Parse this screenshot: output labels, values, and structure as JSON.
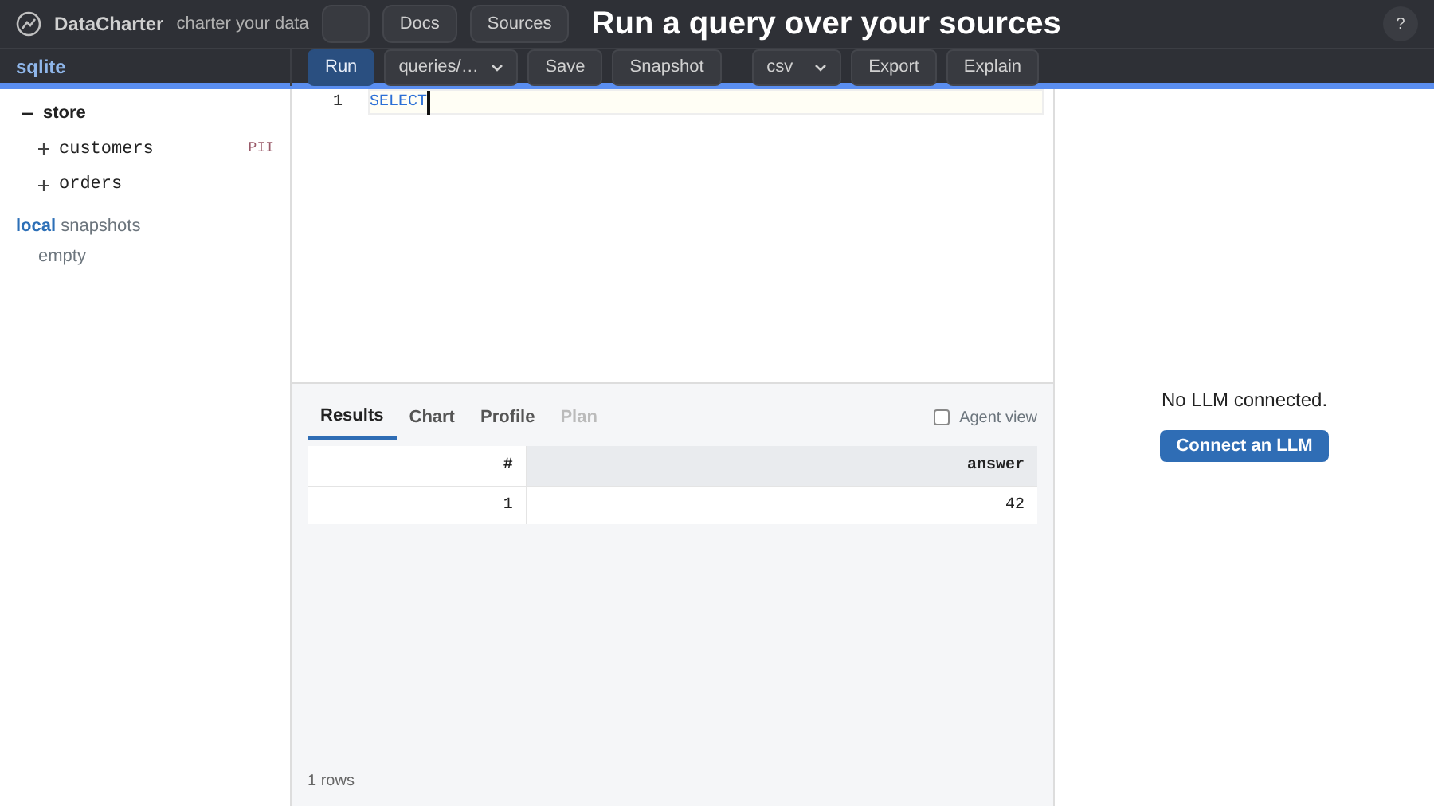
{
  "caption": "Run a query over your sources",
  "header": {
    "app_name": "DataCharter",
    "tagline": "charter your data",
    "nav": [
      "Docs",
      "Sources"
    ],
    "help": "?"
  },
  "sidebar": {
    "sections": [
      {
        "engine": "sqlite",
        "tree": [
          {
            "name": "store",
            "expanded": true,
            "children": [
              {
                "name": "customers",
                "expanded": false,
                "tag": "PII"
              },
              {
                "name": "orders",
                "expanded": false
              }
            ]
          }
        ]
      },
      {
        "engine": "local",
        "label": "snapshots",
        "empty_text": "empty"
      }
    ]
  },
  "toolbar": {
    "run": "Run",
    "file_select": "queries/…",
    "save": "Save",
    "snapshot": "Snapshot",
    "format_select": "csv",
    "export": "Export",
    "explain": "Explain"
  },
  "editor": {
    "lines": [
      {
        "number": "1",
        "code": "SELECT"
      }
    ]
  },
  "results": {
    "tabs": [
      {
        "label": "Results",
        "selected": true,
        "disabled": false
      },
      {
        "label": "Chart",
        "selected": false,
        "disabled": false
      },
      {
        "label": "Profile",
        "selected": false,
        "disabled": false
      },
      {
        "label": "Plan",
        "selected": false,
        "disabled": true
      }
    ],
    "agent_view": {
      "label": "Agent view",
      "checked": false
    },
    "table": {
      "columns": [
        "#",
        "answer"
      ],
      "rows": [
        [
          "1",
          "42"
        ]
      ]
    },
    "row_count": "1 rows"
  },
  "assistant": {
    "message": "No LLM connected.",
    "button": "Connect an LLM"
  }
}
